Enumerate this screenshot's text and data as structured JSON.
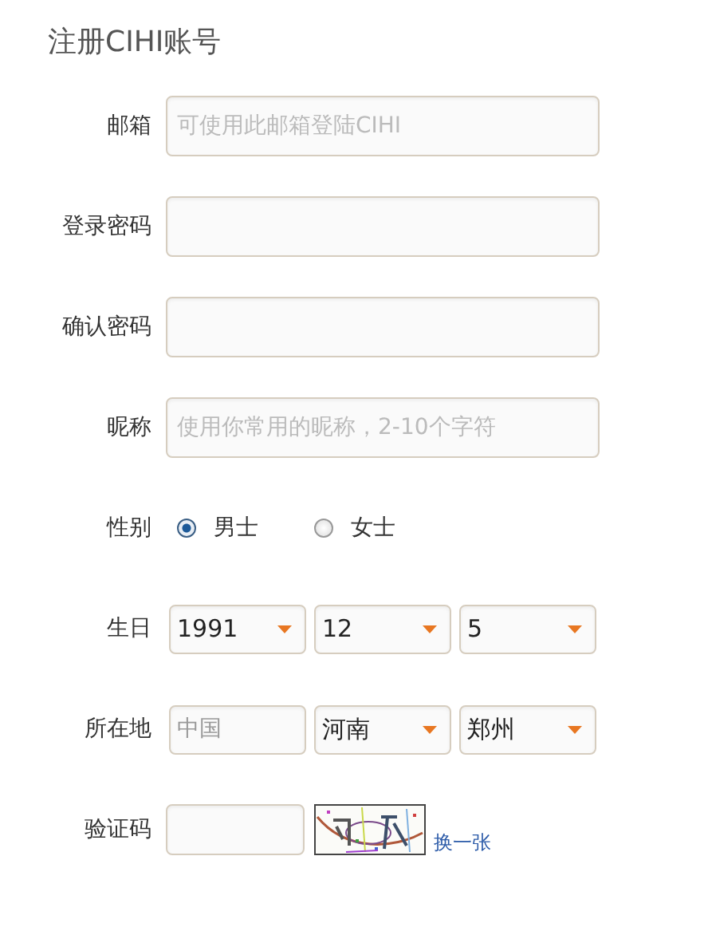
{
  "title": "注册CIHI账号",
  "fields": [
    {
      "label": "邮箱",
      "placeholder": "可使用此邮箱登陆CIHI"
    },
    {
      "label": "登录密码"
    },
    {
      "label": "确认密码"
    },
    {
      "label": "昵称",
      "placeholder": "使用你常用的昵称，2-10个字符"
    }
  ],
  "gender": {
    "label": "性别",
    "options": [
      {
        "label": "男士",
        "selected": true
      },
      {
        "label": "女士",
        "selected": false
      }
    ]
  },
  "birthday": {
    "label": "生日",
    "selects": [
      {
        "value": "1991"
      },
      {
        "value": "12"
      },
      {
        "value": "5"
      }
    ]
  },
  "location": {
    "label": "所在地",
    "parts": [
      {
        "kind": "field",
        "placeholder": "中国"
      },
      {
        "kind": "select",
        "value": "河南"
      },
      {
        "kind": "select",
        "value": "郑州"
      }
    ]
  },
  "captcha": {
    "label": "验证码",
    "refresh_link": "换一张"
  }
}
